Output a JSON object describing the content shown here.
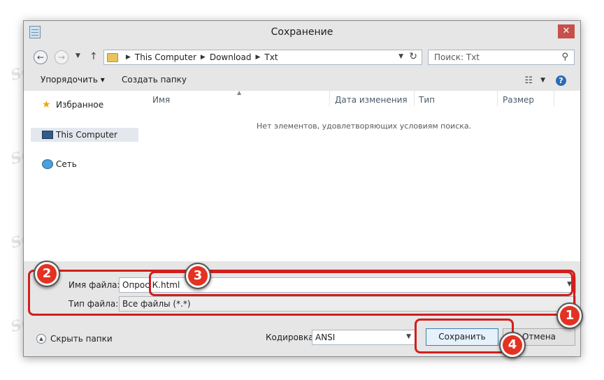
{
  "window": {
    "title": "Сохранение",
    "close_glyph": "✕"
  },
  "nav": {
    "breadcrumbs": [
      "This Computer",
      "Download",
      "Txt"
    ],
    "search_placeholder": "Поиск: Txt"
  },
  "toolbar": {
    "organize_label": "Упорядочить ▾",
    "new_folder_label": "Создать папку"
  },
  "sidebar": {
    "items": [
      {
        "label": "Избранное",
        "icon": "star-icon",
        "selected": false
      },
      {
        "label": "This Computer",
        "icon": "computer-icon",
        "selected": true
      },
      {
        "label": "Сеть",
        "icon": "network-icon",
        "selected": false
      }
    ]
  },
  "file_list": {
    "columns": [
      "Имя",
      "Дата изменения",
      "Тип",
      "Размер"
    ],
    "empty_message": "Нет элементов, удовлетворяющих условиям поиска."
  },
  "fields": {
    "filename_label": "Имя файла:",
    "filename_value": "Опрос К.html",
    "filetype_label": "Тип файла:",
    "filetype_value": "Все файлы (*.*)"
  },
  "bottom": {
    "hide_folders_label": "Скрыть папки",
    "encoding_label": "Кодировка:",
    "encoding_value": "ANSI",
    "save_label": "Сохранить",
    "cancel_label": "Отмена"
  },
  "annotations": {
    "badges": [
      "1",
      "2",
      "3",
      "4"
    ],
    "color": "#d21e1e"
  },
  "watermark": "Soringpcrepair.com"
}
